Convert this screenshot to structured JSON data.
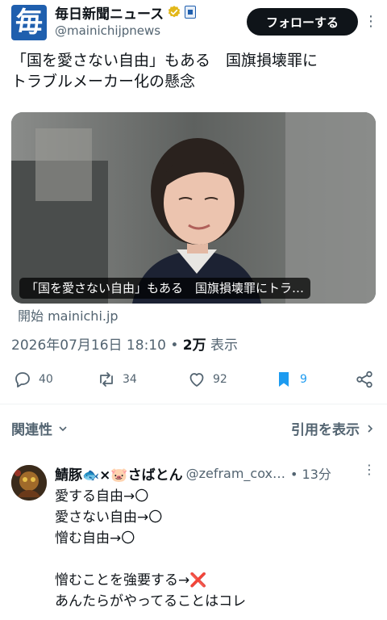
{
  "account": {
    "logo_char": "毎",
    "name": "毎日新聞ニュース",
    "handle": "@mainichijpnews",
    "follow_label": "フォローする",
    "more_label": "⋮"
  },
  "post": {
    "text": "「国を愛さない自由」もある　国旗損壊罪に\nトラブルメーカー化の懸念",
    "card_caption": "「国を愛さない自由」もある　国旗損壊罪にトラ…",
    "card_source": "開始 mainichi.jp",
    "timestamp": "2026年07月16日 18:10",
    "dot": " • ",
    "views": "2万",
    "views_label": " 表示"
  },
  "actions": {
    "replies": "40",
    "reposts": "34",
    "likes": "92",
    "bookmarks": "9"
  },
  "sort": {
    "left_label": "関連性",
    "right_label": "引用を表示"
  },
  "reply": {
    "name": "鯖豚🐟×🐷さばとん",
    "handle": "@zefram_cox…",
    "time": "• 13分",
    "more_label": "⋮",
    "text": "愛する自由→〇\n愛さない自由→〇\n憎む自由→〇\n\n憎むことを強要する→❌\nあんたらがやってることはコレ"
  },
  "colors": {
    "accent": "#1d9bf0",
    "follow_bg": "#0f1419",
    "secondary_text": "#536471",
    "logo_bg": "#1f5fae"
  }
}
